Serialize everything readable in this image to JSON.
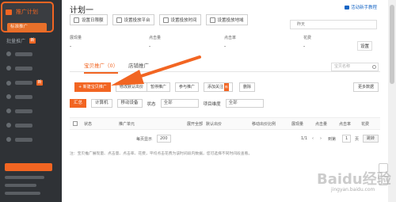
{
  "sidebar": {
    "active_label": "推广计划",
    "active_sub_label": "标准推广",
    "batch_label": "批量推广",
    "batch_badge": "新"
  },
  "header": {
    "title": "计划一",
    "help_label": "活动新手教程"
  },
  "toolbar": {
    "buttons": [
      "设置日限额",
      "设置投放平台",
      "设置投放时间",
      "设置投放地域"
    ]
  },
  "date": {
    "value": "昨天"
  },
  "stats": {
    "labels": [
      "展现量",
      "点击量",
      "点击率",
      "花费"
    ],
    "values": [
      "-",
      "-",
      "-",
      "-"
    ],
    "settings_label": "设置"
  },
  "tabs": {
    "active": "宝贝推广（0）",
    "inactive": "店铺推广"
  },
  "search": {
    "placeholder": "宝贝名称"
  },
  "actions": {
    "new_promo": "+ 新建宝贝推广",
    "buttons": [
      "修改默认出价",
      "暂停推广",
      "参与推广",
      "添加关注",
      "删除"
    ],
    "new_badge": "新",
    "more": "更多数据"
  },
  "filters": {
    "summary": "汇总",
    "computer": "计算机",
    "mobile": "移动设备",
    "status_label": "状态",
    "status_value": "全部",
    "sort_label": "项目维度",
    "sort_value": "全部"
  },
  "table": {
    "headers": [
      "状态",
      "推广单元",
      "展开全部",
      "默认出价",
      "移动出价比例",
      "展现量",
      "点击量",
      "点击率",
      "花费"
    ]
  },
  "pager": {
    "per_page_label": "每页显示",
    "per_page_value": "200",
    "range": "1/1",
    "goto_label": "到第",
    "page_value": "1",
    "page_unit": "页",
    "go_button": "跳转"
  },
  "note": "注：宝贝推广展现量、点击量、点击率、花费，平均点击花费为该时间段内数据，您可选择不同时间段查看。",
  "watermark": {
    "main": "Baidu经验",
    "sub": "jingyan.baidu.com"
  },
  "colors": {
    "accent": "#f26522",
    "sidebar": "#2f3236"
  }
}
